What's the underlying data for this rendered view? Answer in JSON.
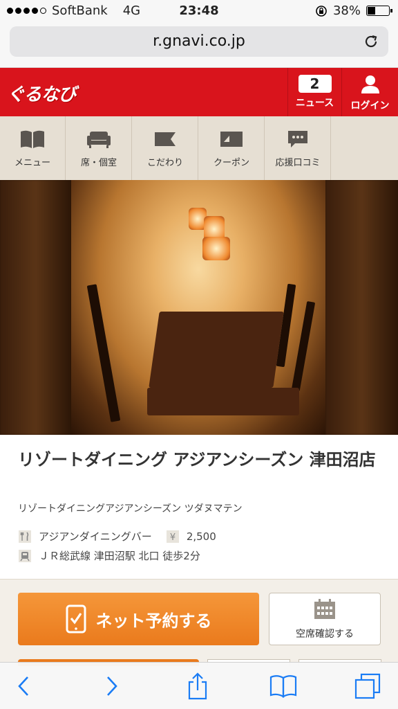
{
  "status": {
    "carrier": "SoftBank",
    "network": "4G",
    "time": "23:48",
    "battery": "38%",
    "battery_level": 0.38
  },
  "browser": {
    "url": "r.gnavi.co.jp"
  },
  "header": {
    "logo": "ぐるなび",
    "news_count": "2",
    "news_label": "ニュース",
    "login_label": "ログイン"
  },
  "nav": {
    "menu": "メニュー",
    "seats": "席・個室",
    "kodawari": "こだわり",
    "coupon": "クーポン",
    "reviews": "応援口コミ"
  },
  "shop": {
    "title": "リゾートダイニング アジアンシーズン 津田沼店",
    "kana": "リゾートダイニングアジアンシーズン ツダヌマテン",
    "genre": "アジアンダイニングバー",
    "price": "2,500",
    "access": "ＪＲ総武線 津田沼駅 北口 徒歩2分"
  },
  "reservation": {
    "net_button": "ネット予約する",
    "vacancy_button": "空席確認する"
  },
  "colors": {
    "brand_red": "#d9141c",
    "orange": "#ea7a1c",
    "ios_blue": "#1a7cf5"
  }
}
